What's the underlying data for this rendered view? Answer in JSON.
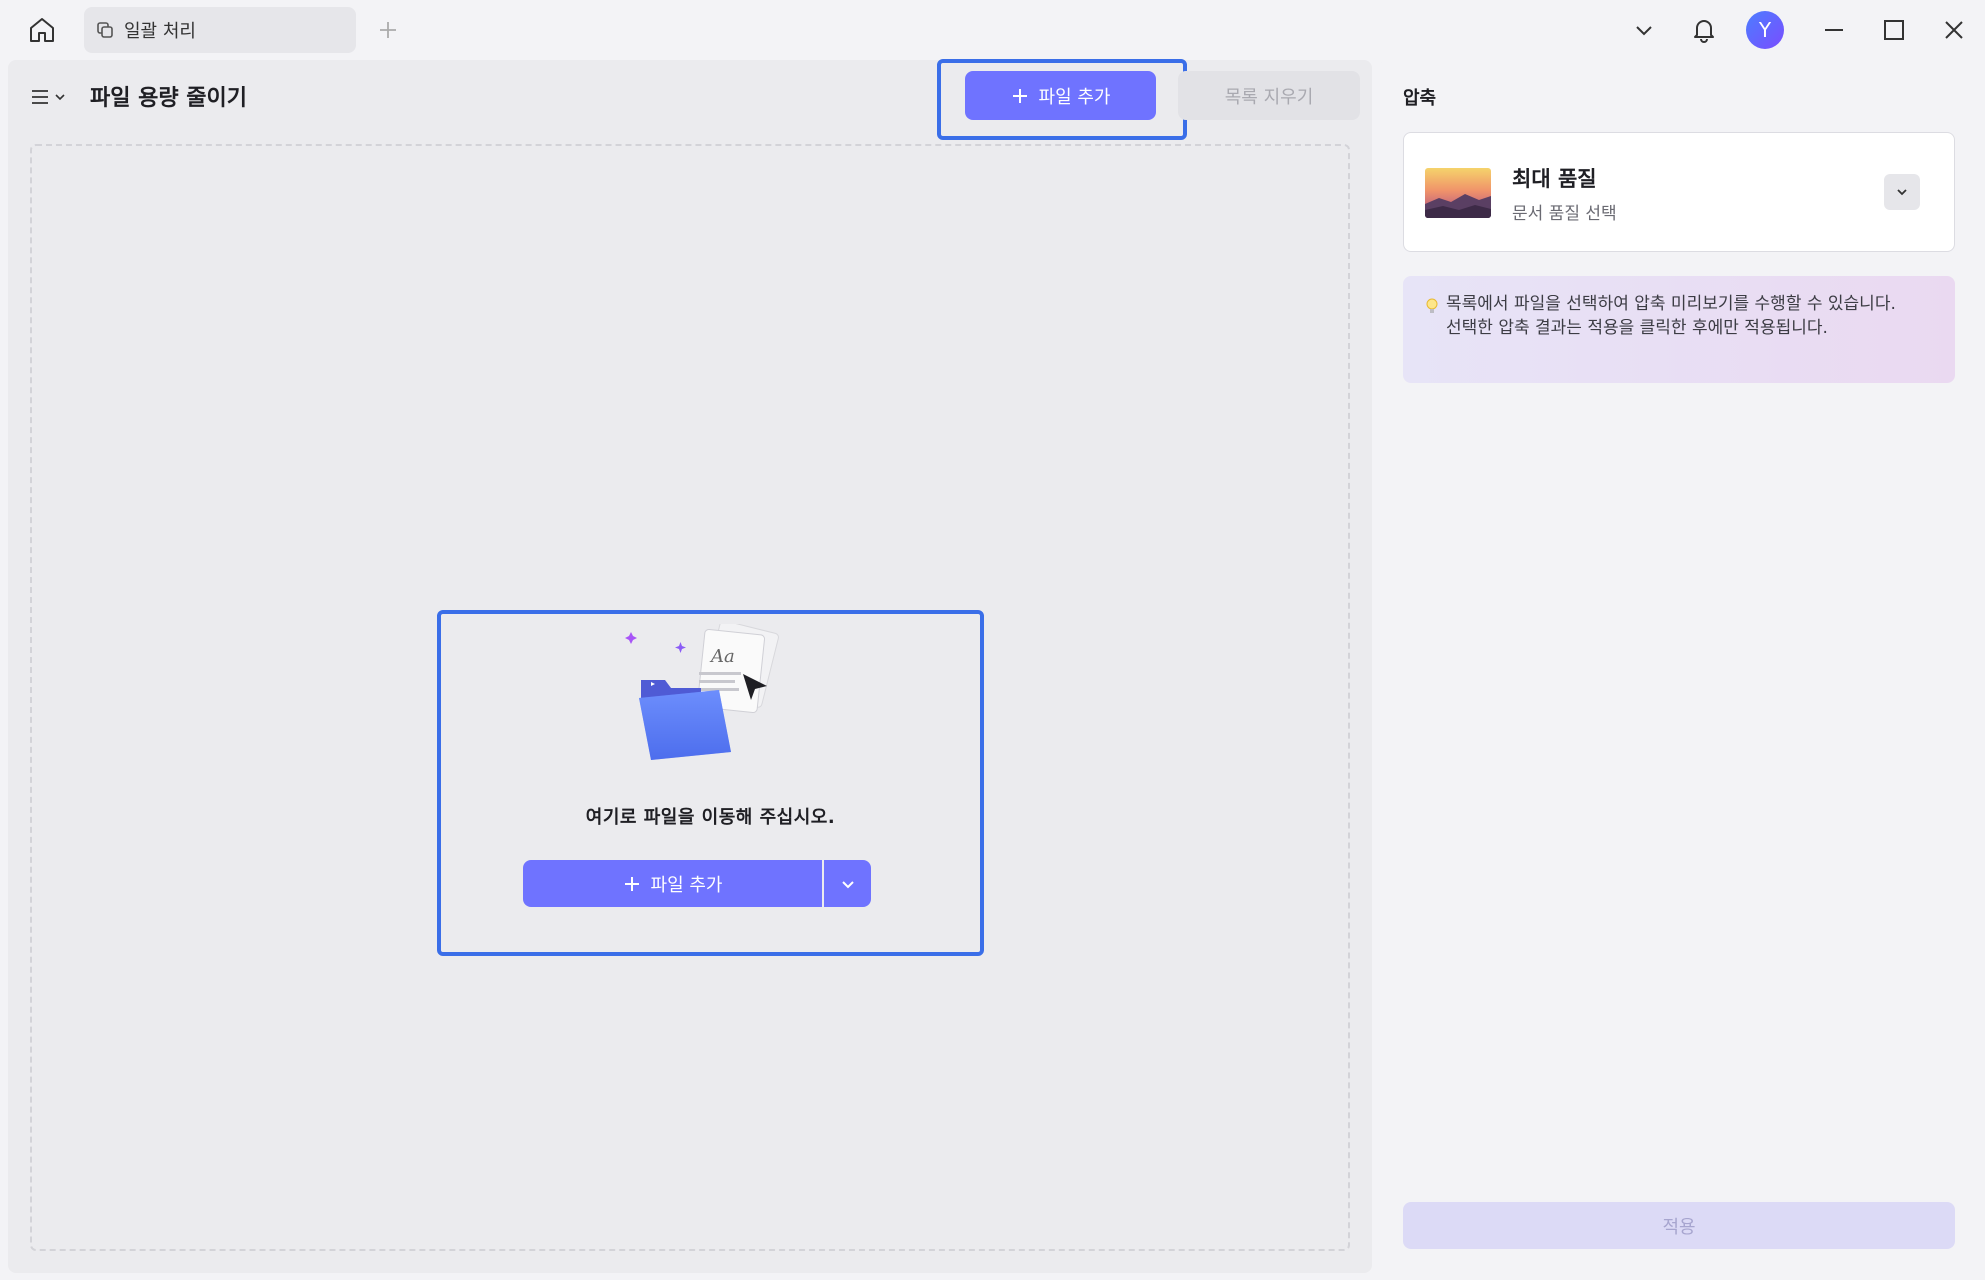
{
  "titlebar": {
    "tab_label": "일괄 처리",
    "avatar_initial": "Y",
    "icons": [
      "home-icon",
      "copy-icon",
      "plus-icon",
      "chevron-down-icon",
      "bell-icon",
      "minimize-icon",
      "maximize-icon",
      "close-icon"
    ]
  },
  "left": {
    "page_title": "파일 용량 줄이기",
    "add_files_label": "파일 추가",
    "clear_list_label": "목록 지우기",
    "drop_text": "여기로 파일을 이동해 주십시오.",
    "add_files_main_label": "파일 추가"
  },
  "right": {
    "section_title": "압축",
    "quality_title": "최대 품질",
    "quality_subtitle": "문서 품질 선택",
    "tip_text": "목록에서 파일을 선택하여 압축 미리보기를 수행할 수 있습니다. 선택한 압축 결과는 적용을 클릭한 후에만 적용됩니다.",
    "apply_label": "적용"
  },
  "colors": {
    "accent": "#6f73ff",
    "highlight": "#3a6ee8",
    "panel": "#ebebee"
  }
}
